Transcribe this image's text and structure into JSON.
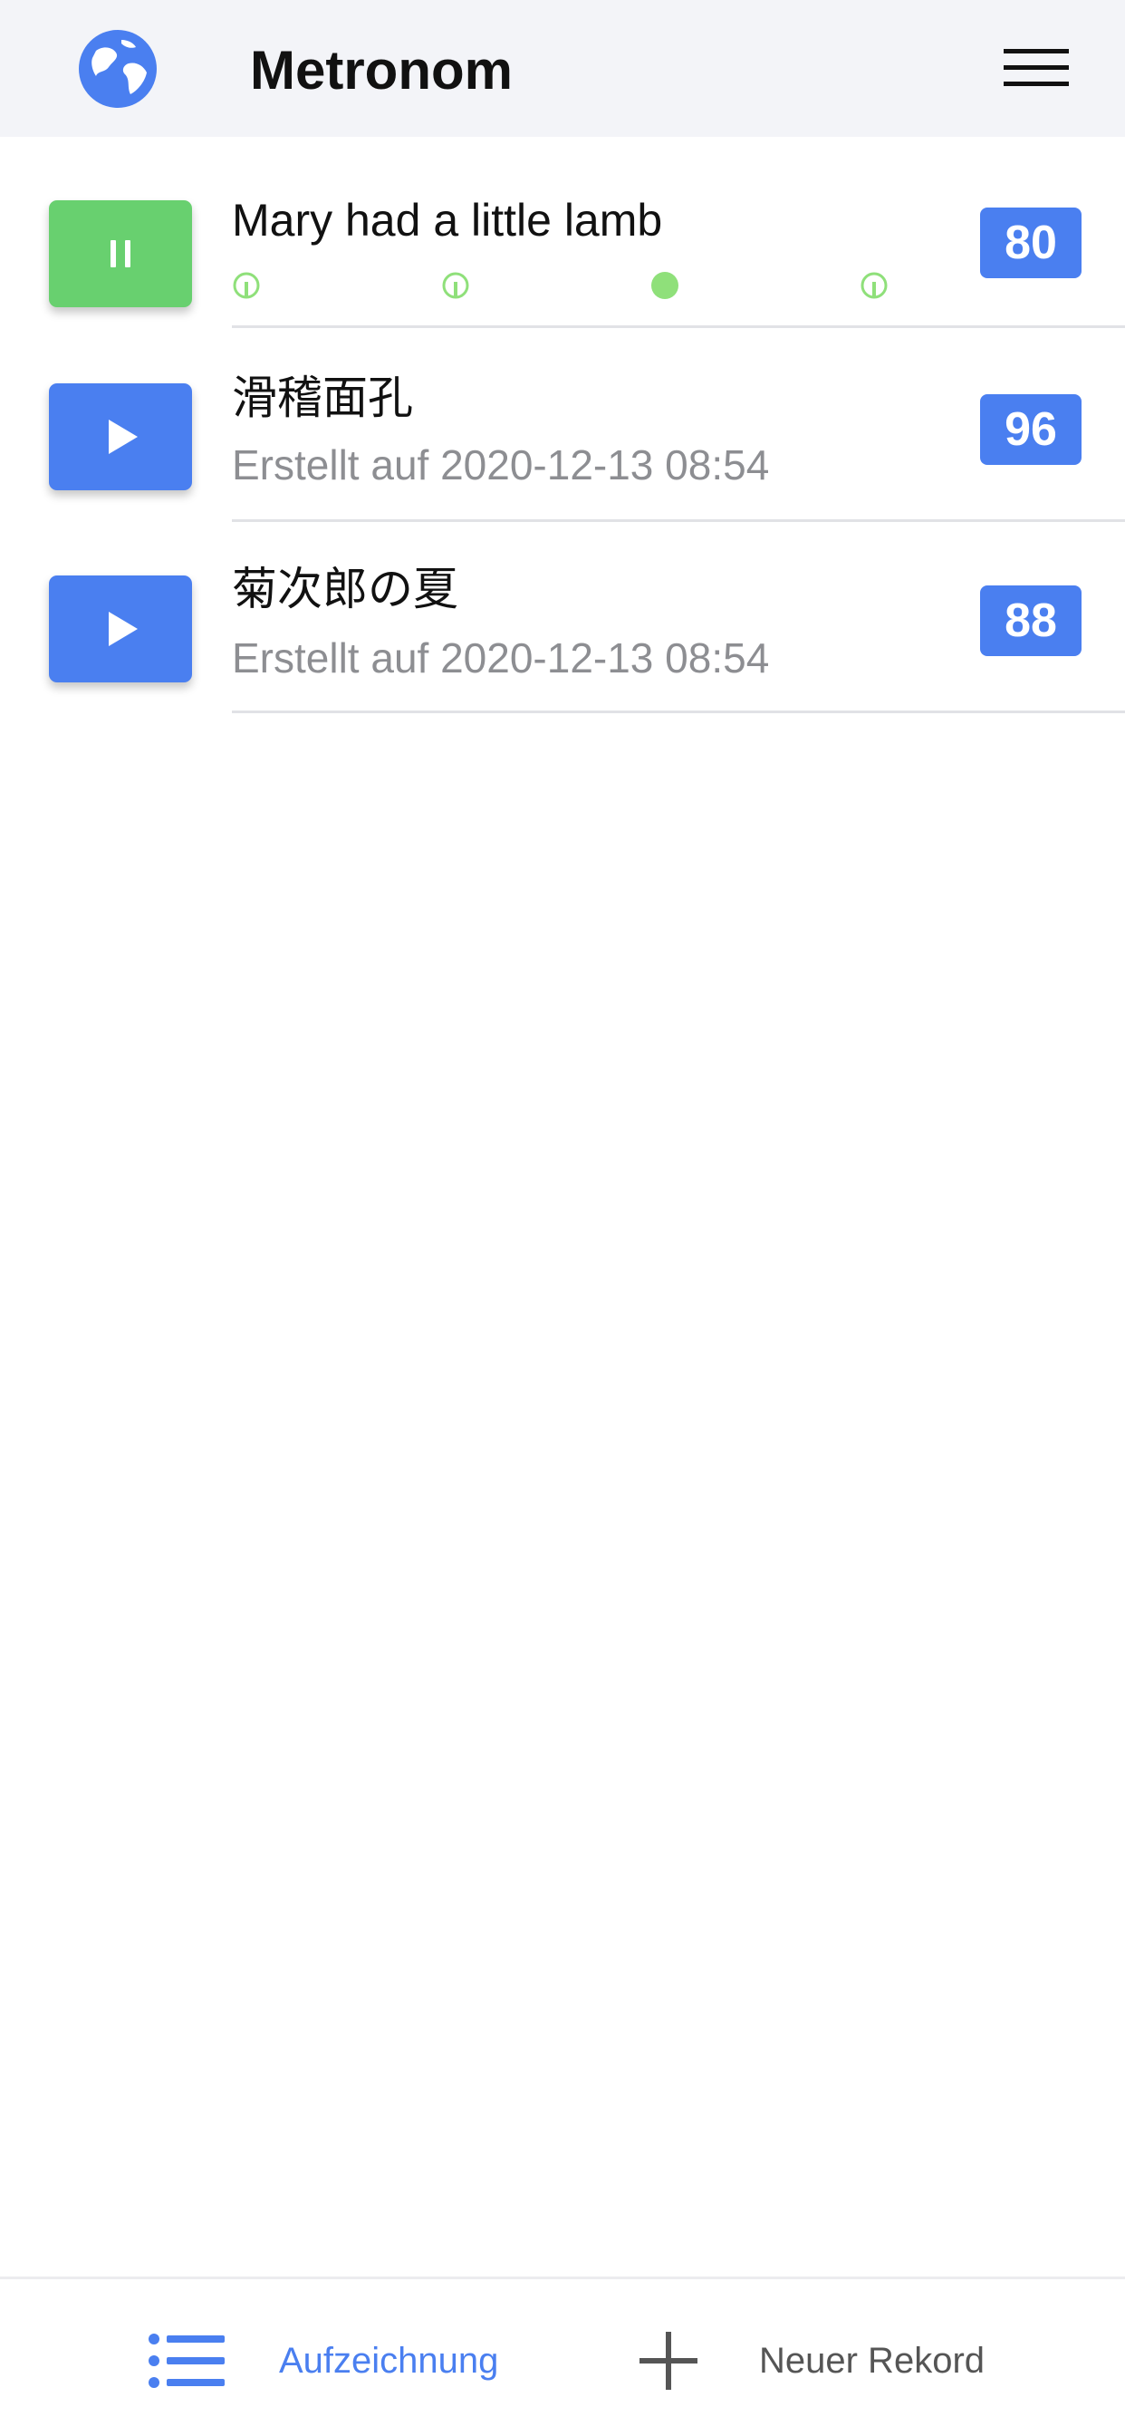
{
  "header": {
    "title": "Metronom",
    "globe_icon": "globe-icon",
    "menu_icon": "hamburger-menu-icon"
  },
  "records": [
    {
      "title": "Mary had a little lamb",
      "bpm": "80",
      "state": "playing",
      "beats_total": 4,
      "active_beat": 3
    },
    {
      "title": "滑稽面孔",
      "subtitle": "Erstellt auf 2020-12-13 08:54",
      "bpm": "96",
      "state": "stopped"
    },
    {
      "title": "菊次郎の夏",
      "subtitle": "Erstellt auf 2020-12-13 08:54",
      "bpm": "88",
      "state": "stopped"
    }
  ],
  "tabbar": {
    "records_label": "Aufzeichnung",
    "new_label": "Neuer Rekord",
    "records_icon": "list-icon",
    "new_icon": "plus-icon"
  },
  "colors": {
    "header_bg": "#f3f4f8",
    "accent_blue": "#4a7ff0",
    "playing_green": "#68d06f",
    "beat_green": "#8fe07a",
    "subtitle_gray": "#8d8e92",
    "tab_inactive": "#555555"
  }
}
